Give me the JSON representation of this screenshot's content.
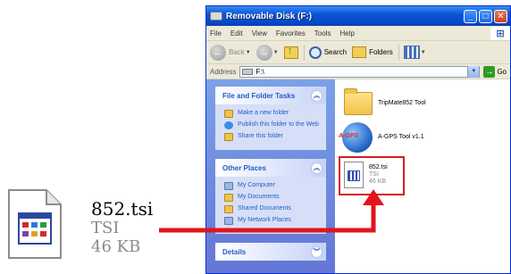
{
  "big_file": {
    "name": "852.tsi",
    "type": "TSI",
    "size": "46 KB",
    "icon": "file-window-icon"
  },
  "window": {
    "title": "Removable Disk (F:)",
    "menu": [
      "File",
      "Edit",
      "View",
      "Favorites",
      "Tools",
      "Help"
    ],
    "toolbar": {
      "back": "Back",
      "search": "Search",
      "folders": "Folders"
    },
    "address": {
      "label": "Address",
      "value": "F:\\",
      "go": "Go"
    },
    "panels": [
      {
        "title": "File and Folder Tasks",
        "items": [
          "Make a new folder",
          "Publish this folder to the Web",
          "Share this folder"
        ]
      },
      {
        "title": "Other Places",
        "items": [
          "My Computer",
          "My Documents",
          "Shared Documents",
          "My Network Places"
        ]
      },
      {
        "title": "Details",
        "items": []
      }
    ],
    "files": [
      {
        "name": "TripMate852 Tool",
        "icon": "folder-icon"
      },
      {
        "name": "A-GPS Tool v1.1",
        "icon": "agps-globe-icon",
        "badge": "A-GPS"
      },
      {
        "name": "852.tsi",
        "type": "TSI",
        "size": "46 KB",
        "icon": "file-window-icon"
      }
    ]
  },
  "colors": {
    "title_bar": "#0a55d8",
    "task_pane": "#6f8fdf",
    "highlight": "#d41d24"
  }
}
